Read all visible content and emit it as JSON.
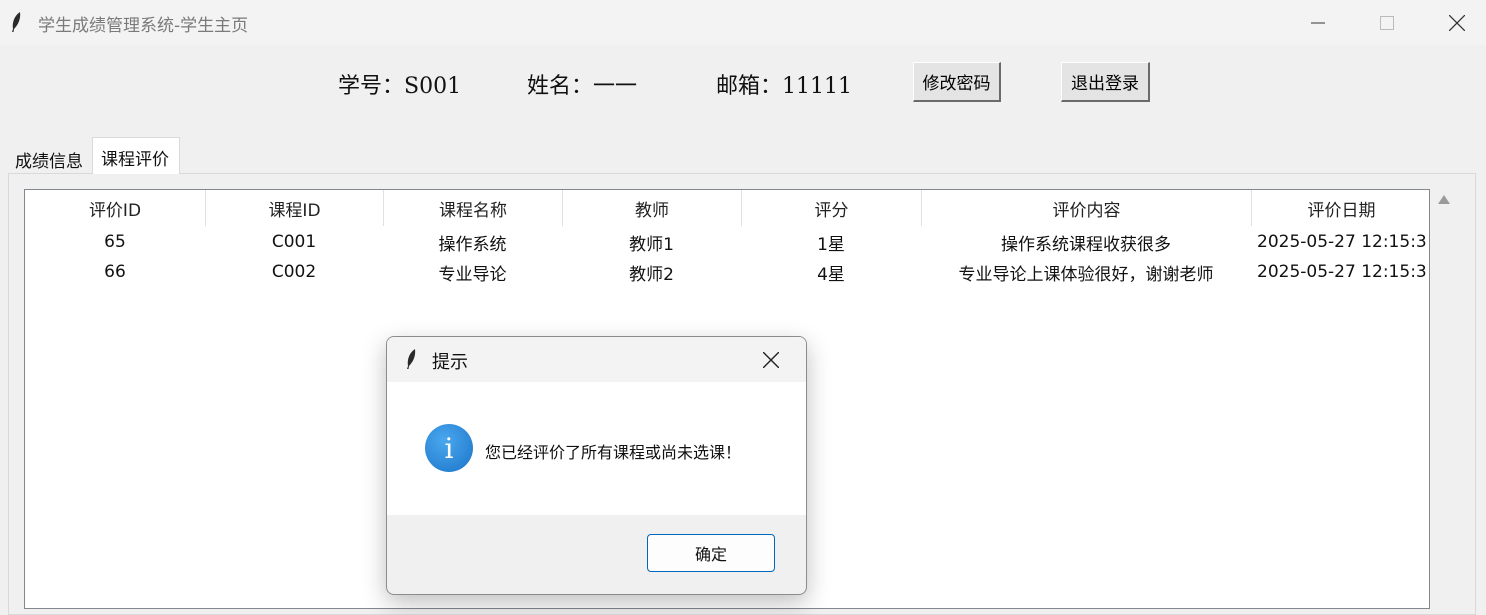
{
  "window": {
    "title": "学生成绩管理系统-学生主页",
    "controls": {
      "minimize": "minimize-icon",
      "maximize": "maximize-icon",
      "close": "close-icon"
    }
  },
  "info": {
    "student_id": "学号：S001",
    "name": "姓名：一一",
    "email": "邮箱：11111",
    "change_password": "修改密码",
    "logout": "退出登录"
  },
  "tabs": [
    {
      "label": "成绩信息",
      "active": false
    },
    {
      "label": "课程评价",
      "active": true
    }
  ],
  "table": {
    "columns": [
      "评价ID",
      "课程ID",
      "课程名称",
      "教师",
      "评分",
      "评价内容",
      "评价日期"
    ],
    "rows": [
      [
        "65",
        "C001",
        "操作系统",
        "教师1",
        "1星",
        "操作系统课程收获很多",
        "2025-05-27 12:15:3"
      ],
      [
        "66",
        "C002",
        "专业导论",
        "教师2",
        "4星",
        "专业导论上课体验很好，谢谢老师",
        "2025-05-27 12:15:3"
      ]
    ]
  },
  "dialog": {
    "title": "提示",
    "icon": "info-icon",
    "icon_glyph": "i",
    "message": "您已经评价了所有课程或尚未选课！",
    "ok": "确定"
  },
  "colors": {
    "accent": "#0067c0",
    "info_icon": "#1b73c8"
  }
}
